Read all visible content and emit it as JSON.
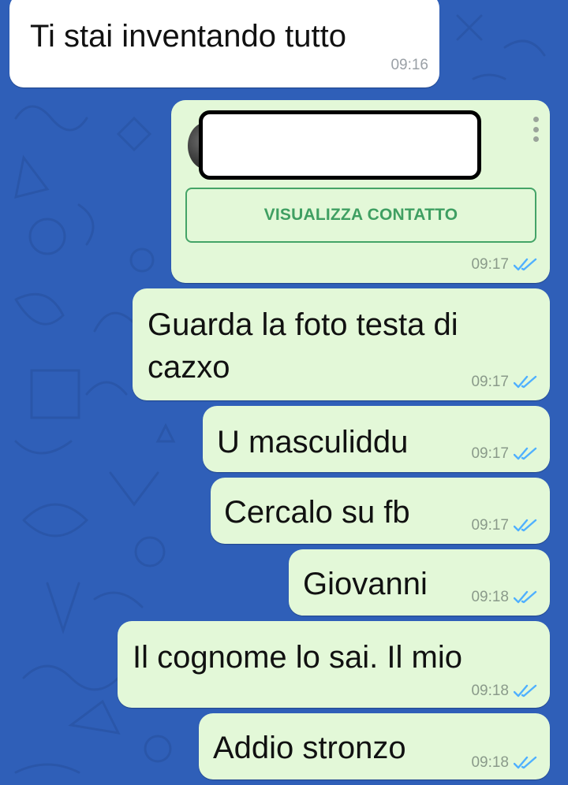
{
  "colors": {
    "wallpaper": "#2f5fb8",
    "incoming_bubble": "#ffffff",
    "outgoing_bubble": "#e3f8d8",
    "read_ticks": "#4fb0ff",
    "accent_green": "#3f9f62"
  },
  "messages": [
    {
      "direction": "incoming",
      "text": "Ti stai inventando tutto",
      "time": "09:16"
    },
    {
      "direction": "outgoing",
      "type": "contact",
      "time": "09:17",
      "status": "read"
    },
    {
      "direction": "outgoing",
      "text_line1": "Guarda la foto testa di",
      "text_line2": "cazxo",
      "time": "09:17",
      "status": "read"
    },
    {
      "direction": "outgoing",
      "text": "U masculiddu",
      "time": "09:17",
      "status": "read"
    },
    {
      "direction": "outgoing",
      "text": "Cercalo su fb",
      "time": "09:17",
      "status": "read"
    },
    {
      "direction": "outgoing",
      "text": "Giovanni",
      "time": "09:18",
      "status": "read"
    },
    {
      "direction": "outgoing",
      "text": "Il cognome lo sai. Il mio",
      "time": "09:18",
      "status": "read"
    },
    {
      "direction": "outgoing",
      "text": "Addio stronzo",
      "time": "09:18",
      "status": "read"
    }
  ],
  "contact_card": {
    "button_label": "VISUALIZZA CONTATTO",
    "menu_icon": "more-vert-icon"
  }
}
